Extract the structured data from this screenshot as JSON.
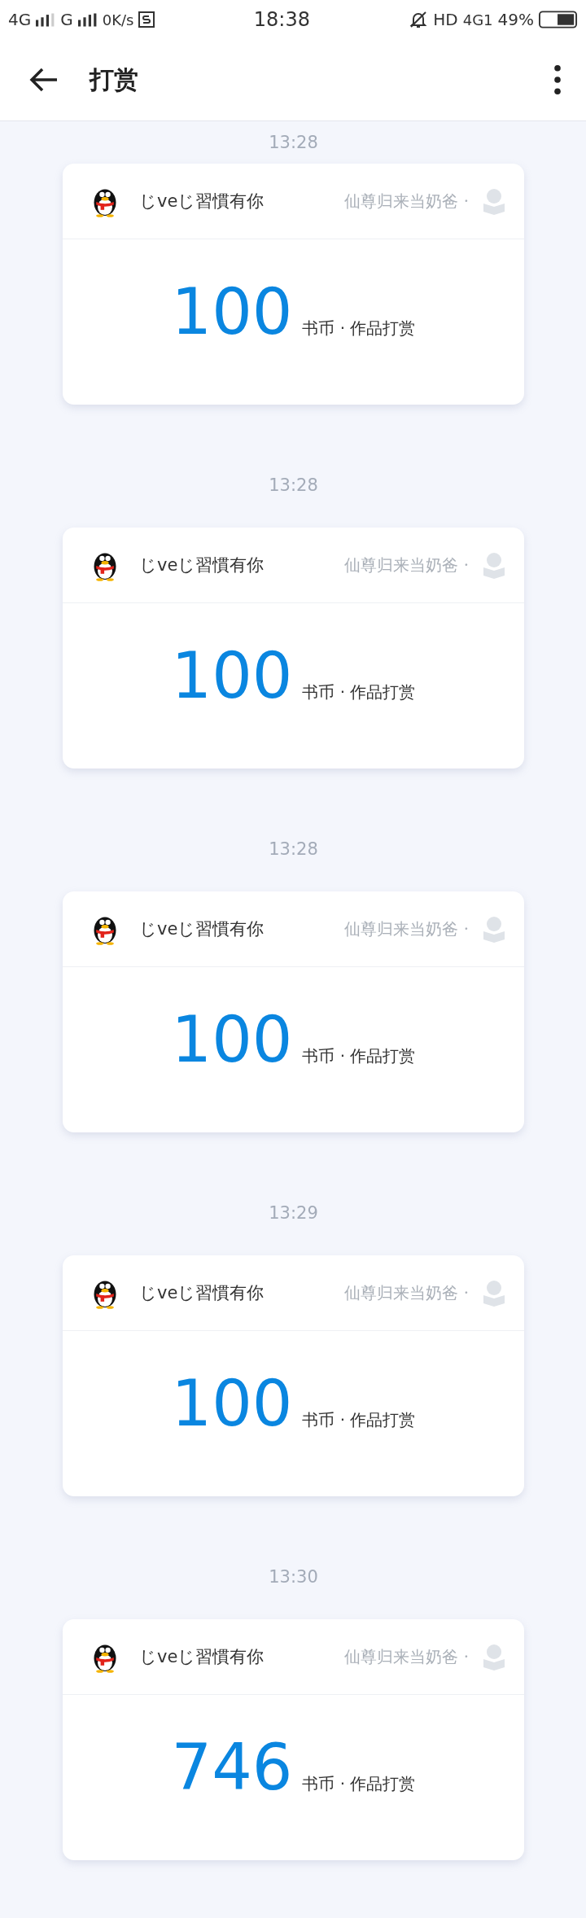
{
  "status_bar": {
    "network_1": "4G",
    "network_2": "G",
    "speed": "0K/s",
    "time": "18:38",
    "hd": "HD",
    "network_3": "4G1",
    "battery": "49%"
  },
  "app_bar": {
    "title": "打赏"
  },
  "rewards": [
    {
      "time": "13:28",
      "user": "じveじ習慣有你",
      "book": "仙尊归来当奶爸 ·",
      "amount": "100",
      "unit": "书币 · 作品打赏"
    },
    {
      "time": "13:28",
      "user": "じveじ習慣有你",
      "book": "仙尊归来当奶爸 ·",
      "amount": "100",
      "unit": "书币 · 作品打赏"
    },
    {
      "time": "13:28",
      "user": "じveじ習慣有你",
      "book": "仙尊归来当奶爸 ·",
      "amount": "100",
      "unit": "书币 · 作品打赏"
    },
    {
      "time": "13:29",
      "user": "じveじ習慣有你",
      "book": "仙尊归来当奶爸 ·",
      "amount": "100",
      "unit": "书币 · 作品打赏"
    },
    {
      "time": "13:30",
      "user": "じveじ習慣有你",
      "book": "仙尊归来当奶爸 ·",
      "amount": "746",
      "unit": "书币 · 作品打赏"
    }
  ]
}
